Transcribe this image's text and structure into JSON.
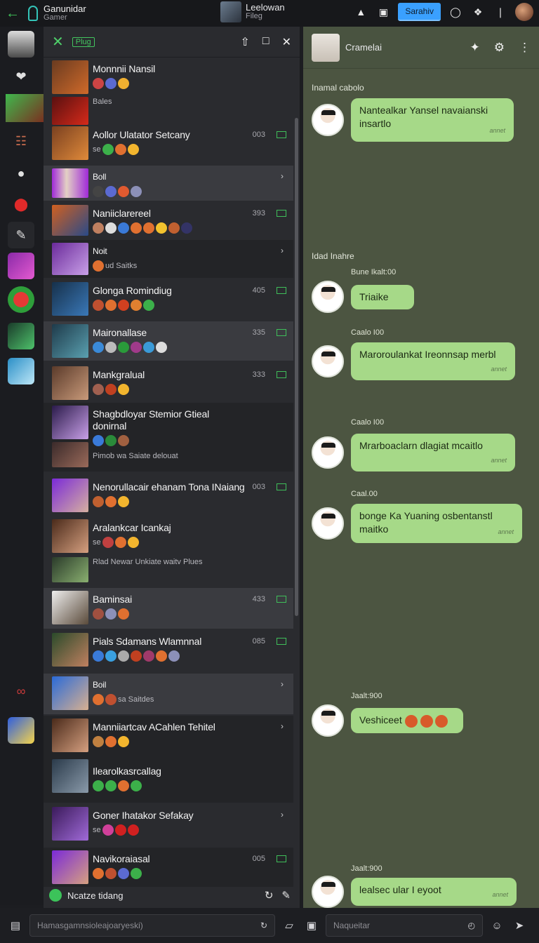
{
  "topbar": {
    "app_title": "Ganunidar",
    "app_subtitle": "Gamer",
    "user_name": "Leelowan",
    "user_status": "Fileg",
    "search_label": "Sarahiv"
  },
  "list": {
    "header_tag": "Plug",
    "footer_label": "Ncatze tidang",
    "rows": [
      {
        "name": "Monnnii Nansil",
        "sub": "Bales",
        "count": ""
      },
      {
        "name": "Aollor Ulatator Setcany",
        "sub": "se",
        "count": "003"
      },
      {
        "name": "Boll",
        "sub": "",
        "count": ""
      },
      {
        "name": "Naniiclarereel",
        "sub": "",
        "count": "393"
      },
      {
        "name": "Noit",
        "sub": "ud Saitks",
        "count": ""
      },
      {
        "name": "Glonga Romindiug",
        "sub": "",
        "count": "405"
      },
      {
        "name": "Maironallase",
        "sub": "",
        "count": "335"
      },
      {
        "name": "Mankgralual",
        "sub": "",
        "count": "333"
      },
      {
        "name": "Shagbdloyar Stemior Gtieal donirnal",
        "sub": "Pimob wa Saiate delouat",
        "count": ""
      },
      {
        "name": "Nenorullacair ehanam Tona INaiang",
        "sub": "",
        "count": "003"
      },
      {
        "name": "Aralankcar Icankaj",
        "sub": "se",
        "count": ""
      },
      {
        "name": "Rlad Newar Unkiate waitv Plues",
        "sub": "",
        "count": ""
      },
      {
        "name": "Baminsai",
        "sub": "",
        "count": "433"
      },
      {
        "name": "Pials Sdamans Wlamnnal",
        "sub": "",
        "count": "085"
      },
      {
        "name": "Boil",
        "sub": "sa Saitdes",
        "count": ""
      },
      {
        "name": "Manniiartcav ACahlen Tehitel",
        "sub": "",
        "count": ""
      },
      {
        "name": "Ilearolkasrcallag",
        "sub": "",
        "count": ""
      },
      {
        "name": "Goner Ihatakor Sefakay",
        "sub": "se",
        "count": ""
      },
      {
        "name": "Navikoraiasal",
        "sub": "",
        "count": "005"
      }
    ]
  },
  "chat": {
    "contact_name": "Cramelai",
    "days": [
      "Inamal cabolo",
      "Idad Inahre"
    ],
    "times": [
      "Bune Ikalt:00",
      "Caalo I00",
      "Caalo I00",
      "Caal.00",
      "Jaalt:900",
      "Jaalt:900"
    ],
    "messages": [
      {
        "text": "Nantealkar Yansel navaianski insartlo",
        "meta": "annet"
      },
      {
        "text": "Triaike",
        "meta": ""
      },
      {
        "text": "Maroroulankat Ireonnsap merbl",
        "meta": "annet"
      },
      {
        "text": "Mrarboaclarn dlagiat mcaitlo",
        "meta": "annet"
      },
      {
        "text": "bonge Ka Yuaning osbentanstl maitko",
        "meta": "annet"
      },
      {
        "text": "Veshiceet",
        "meta": ""
      },
      {
        "text": "lealsec ular I eyoot",
        "meta": "annet"
      }
    ]
  },
  "composer": {
    "search_placeholder": "Hamasgamnsioleajoaryeski)",
    "message_placeholder": "Naqueitar"
  }
}
